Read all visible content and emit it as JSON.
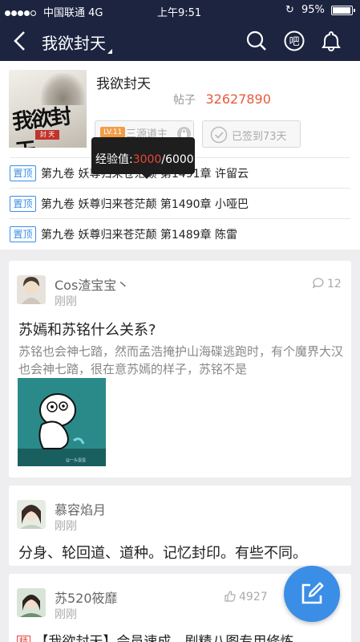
{
  "status_bar": {
    "carrier": "中国联通",
    "network": "4G",
    "time": "上午9:51",
    "battery": "95%",
    "battery_level": 0.95
  },
  "nav": {
    "title": "我欲封天"
  },
  "forum": {
    "name": "我欲封天",
    "logo_text": "我欲封天",
    "logo_seal": "封 天",
    "stats_label": "帖子",
    "post_count": "32627890",
    "level_badge": "LV.11",
    "level_name": "三源道主",
    "level_progress": 0.5,
    "checkin_label": "已签到73天",
    "tooltip": {
      "label": "经验值:",
      "current": "3000",
      "total": "/6000"
    }
  },
  "pinned": [
    {
      "tag": "置顶",
      "text": "第九卷 妖尊归来苍茫颠 第1491章 许留云"
    },
    {
      "tag": "置顶",
      "text": "第九卷 妖尊归来苍茫颠 第1490章 小哑巴"
    },
    {
      "tag": "置顶",
      "text": "第九卷 妖尊归来苍茫颠 第1489章 陈雷"
    }
  ],
  "posts": [
    {
      "user": "Cos渣宝宝丶",
      "time": "刚刚",
      "replies": "12",
      "title": "苏嫣和苏铭什么关系?",
      "body": "苏铭也会神七踏，然而孟浩掩护山海碟逃跑时，有个魔界大汉也会神七踏，很在意苏嫣的样子，苏铭不是",
      "image_caption": "@一头蛋蛋"
    },
    {
      "user": "慕容焰月",
      "time": "刚刚",
      "title": "分身、轮回道、道种。记忆封印。有些不同。"
    },
    {
      "user": "苏520筱靡",
      "time": "刚刚",
      "likes": "4927",
      "tag": "精",
      "title": "【我欲封天】会员速成，剧精八图专用修炼"
    }
  ]
}
